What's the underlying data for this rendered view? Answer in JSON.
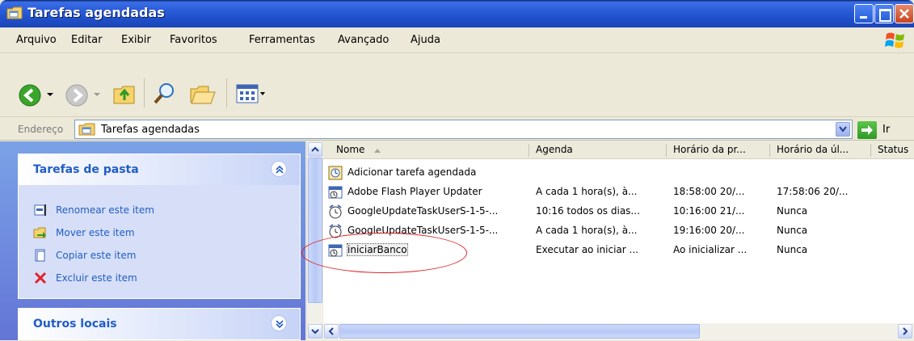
{
  "window": {
    "title": "Tarefas agendadas"
  },
  "menu": [
    "Arquivo",
    "Editar",
    "Exibir",
    "Favoritos",
    "Ferramentas",
    "Avançado",
    "Ajuda"
  ],
  "address": {
    "label": "Endereço",
    "value": "Tarefas agendadas",
    "go_label": "Ir"
  },
  "panels": {
    "folder_tasks": {
      "title": "Tarefas de pasta",
      "items": [
        "Renomear este item",
        "Mover este item",
        "Copiar este item",
        "Excluir este item"
      ]
    },
    "other_places": {
      "title": "Outros locais"
    }
  },
  "list": {
    "columns": [
      "Nome",
      "Agenda",
      "Horário da pr...",
      "Horário da úl...",
      "Status"
    ],
    "rows": [
      {
        "name": "Adicionar tarefa agendada",
        "agenda": "",
        "next": "",
        "last": "",
        "status": "",
        "icon": "add-task-icon"
      },
      {
        "name": "Adobe Flash Player Updater",
        "agenda": "A cada 1 hora(s), à...",
        "next": "18:58:00  20/...",
        "last": "17:58:06  20/...",
        "status": "",
        "icon": "scheduled-task-icon"
      },
      {
        "name": "GoogleUpdateTaskUserS-1-5-...",
        "agenda": "10:16 todos os dias...",
        "next": "10:16:00  21/...",
        "last": "Nunca",
        "status": "",
        "icon": "scheduled-task-icon"
      },
      {
        "name": "GoogleUpdateTaskUserS-1-5-...",
        "agenda": "A cada 1 hora(s), à...",
        "next": "19:16:00  20/...",
        "last": "Nunca",
        "status": "",
        "icon": "scheduled-task-icon"
      },
      {
        "name": "iniciarBanco",
        "agenda": "Executar ao iniciar ...",
        "next": "Ao inicializar ...",
        "last": "Nunca",
        "status": "",
        "icon": "scheduled-task-icon"
      }
    ]
  },
  "colors": {
    "title_bar": "#2A5BD7",
    "task_pane": "#7BA2E7",
    "panel_title": "#215DC6",
    "highlight_ellipse": "#E0242A"
  }
}
